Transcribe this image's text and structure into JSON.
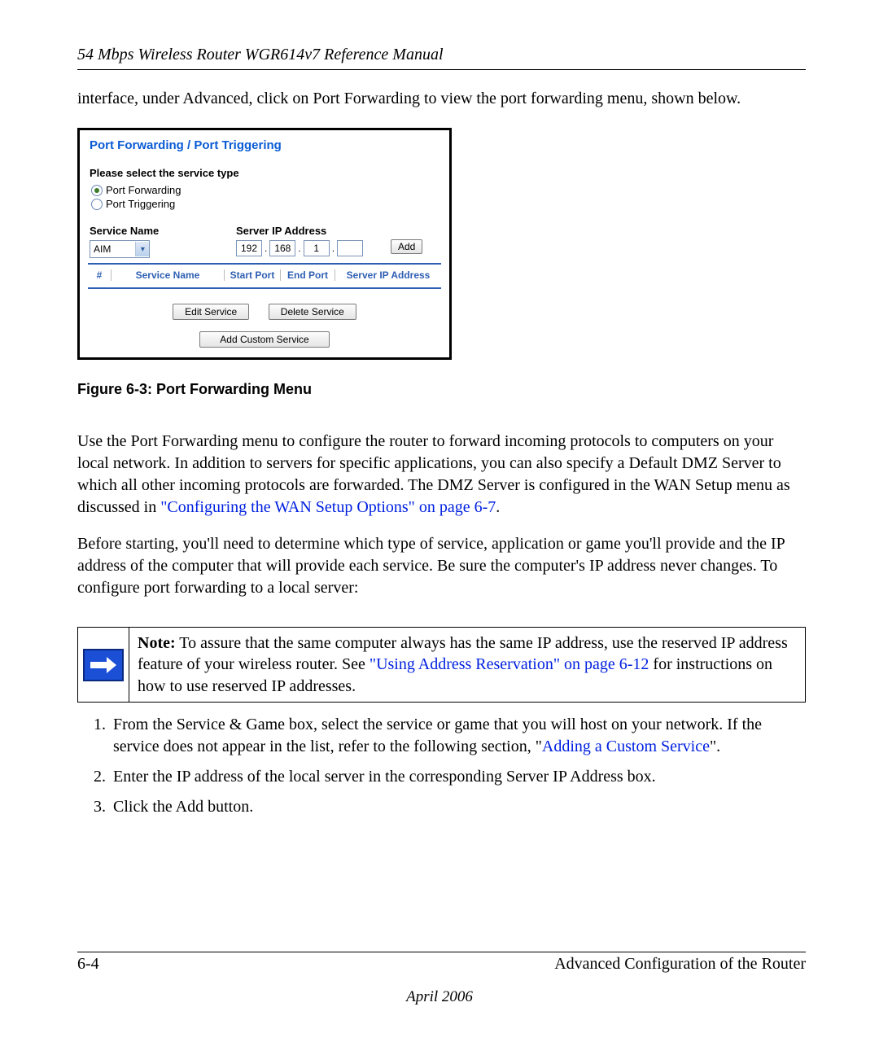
{
  "header": {
    "title": "54 Mbps Wireless Router WGR614v7 Reference Manual"
  },
  "intro": "interface, under Advanced, click on Port Forwarding to view the port forwarding menu, shown below.",
  "screenshot": {
    "title": "Port Forwarding / Port Triggering",
    "select_label": "Please select the service type",
    "radio1": "Port Forwarding",
    "radio2": "Port Triggering",
    "service_name_label": "Service Name",
    "server_ip_label": "Server IP Address",
    "service_select": "AIM",
    "ip": {
      "a": "192",
      "b": "168",
      "c": "1",
      "d": ""
    },
    "add_btn": "Add",
    "th_num": "#",
    "th_service": "Service Name",
    "th_start": "Start Port",
    "th_end": "End Port",
    "th_ip": "Server IP Address",
    "edit_btn": "Edit Service",
    "delete_btn": "Delete Service",
    "custom_btn": "Add Custom Service"
  },
  "figure_caption": "Figure 6-3:  Port Forwarding Menu",
  "para1_a": "Use the Port Forwarding menu to configure the router to forward incoming protocols to computers on your local network. In addition to servers for specific applications, you can also specify a Default DMZ Server to which all other incoming protocols are forwarded. The DMZ Server is configured in the WAN Setup menu as discussed in ",
  "para1_link": "\"Configuring the WAN Setup Options\" on page 6-7",
  "para1_b": ".",
  "para2": "Before starting, you'll need to determine which type of service, application or game you'll provide and the IP address of the computer that will provide each service. Be sure the computer's IP address never changes. To configure port forwarding to a local server:",
  "note": {
    "label": "Note:",
    "text_a": " To assure that the same computer always has the same IP address, use the reserved IP address feature of your wireless router. See ",
    "link": "\"Using Address Reservation\" on page 6-12",
    "text_b": " for instructions on how to use reserved IP addresses."
  },
  "steps": {
    "s1a": "From the Service & Game box, select the service or game that you will host on your network. If the service does not appear in the list, refer to the following section, \"",
    "s1link": "Adding a Custom Service",
    "s1b": "\".",
    "s2": "Enter the IP address of the local server in the corresponding Server IP Address box.",
    "s3": "Click the Add button."
  },
  "footer": {
    "page": "6-4",
    "section": "Advanced Configuration of the Router",
    "date": "April 2006"
  }
}
